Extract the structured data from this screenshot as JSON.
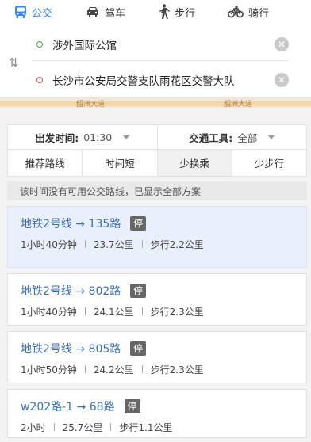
{
  "modes": [
    {
      "label": "公交",
      "icon": "bus-icon",
      "active": true
    },
    {
      "label": "驾车",
      "icon": "car-icon",
      "active": false
    },
    {
      "label": "步行",
      "icon": "walk-icon",
      "active": false
    },
    {
      "label": "骑行",
      "icon": "bike-icon",
      "active": false
    }
  ],
  "route": {
    "from": "涉外国际公馆",
    "to": "长沙市公安局交警支队雨花区交警大队"
  },
  "map": {
    "road_label_1": "韶洲大道",
    "road_label_2": "韶洲大道"
  },
  "filters": {
    "depart_label": "出发时间:",
    "depart_value": "01:30",
    "vehicle_label": "交通工具:",
    "vehicle_value": "全部"
  },
  "tabs": [
    "推荐路线",
    "时间短",
    "少换乘",
    "少步行"
  ],
  "active_tab": 2,
  "notice": "该时间没有可用公交路线，已显示全部方案",
  "routes": [
    {
      "name": "地铁2号线 → 135路",
      "badge": "停",
      "duration": "1小时40分钟",
      "distance": "23.7公里",
      "walk": "步行2.2公里",
      "selected": true
    },
    {
      "name": "地铁2号线 → 802路",
      "badge": "停",
      "duration": "1小时40分钟",
      "distance": "24.1公里",
      "walk": "步行2.3公里",
      "selected": false
    },
    {
      "name": "地铁2号线 → 805路",
      "badge": "停",
      "duration": "1小时50分钟",
      "distance": "24.2公里",
      "walk": "步行2.3公里",
      "selected": false
    },
    {
      "name": "w202路-1 → 68路",
      "badge": "停",
      "duration": "2小时",
      "distance": "25.7公里",
      "walk": "步行1.1公里",
      "selected": false
    }
  ],
  "colors": {
    "accent": "#3385ff",
    "link": "#3a6fb8",
    "selected_bg": "#eaf0fb"
  }
}
